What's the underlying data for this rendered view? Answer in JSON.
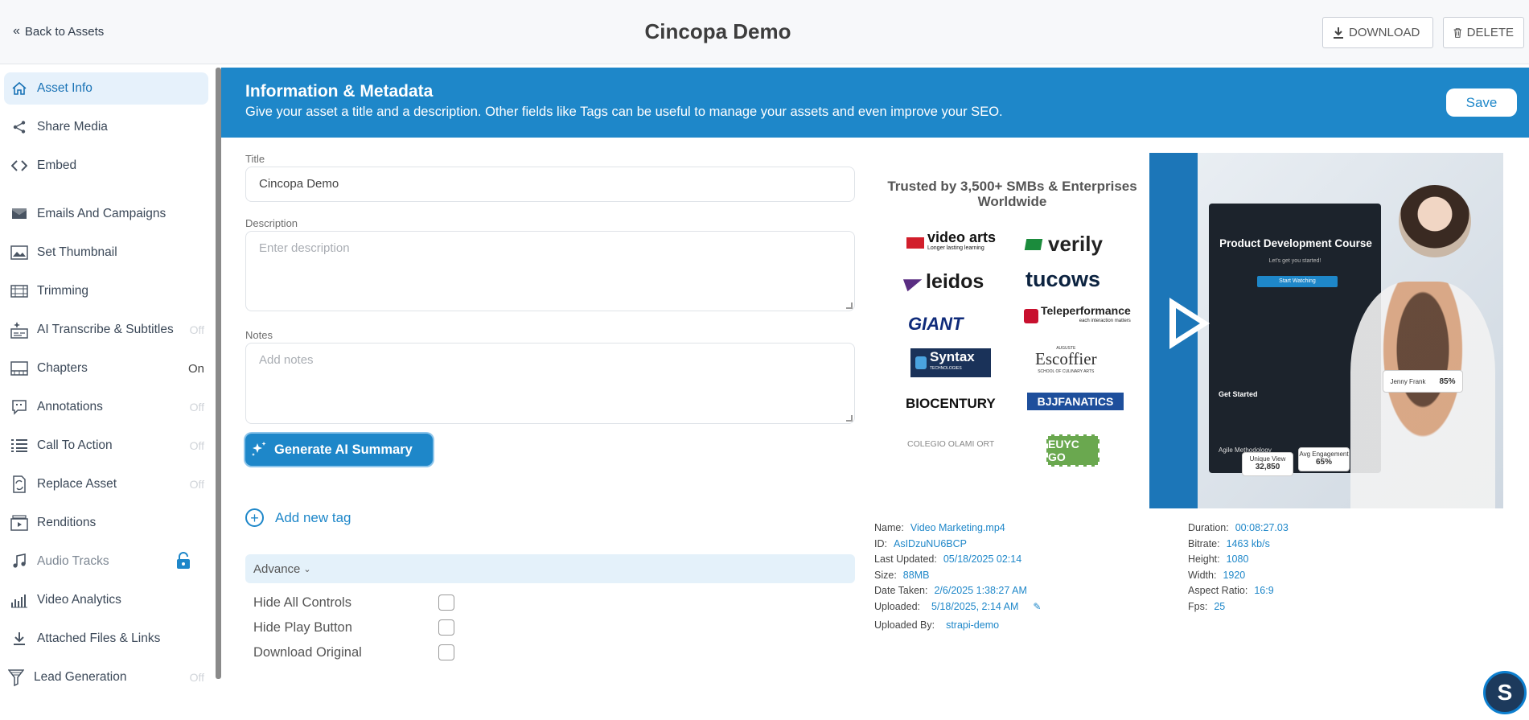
{
  "header": {
    "back_label": "Back to Assets",
    "title": "Cincopa Demo",
    "download_label": "DOWNLOAD",
    "delete_label": "DELETE"
  },
  "sidebar": {
    "items": [
      {
        "label": "Asset Info",
        "icon": "home-icon",
        "state": ""
      },
      {
        "label": "Share Media",
        "icon": "share-icon",
        "state": ""
      },
      {
        "label": "Embed",
        "icon": "code-icon",
        "state": ""
      },
      {
        "label": "Emails And Campaigns",
        "icon": "mail-icon",
        "state": ""
      },
      {
        "label": "Set Thumbnail",
        "icon": "image-icon",
        "state": ""
      },
      {
        "label": "Trimming",
        "icon": "trim-icon",
        "state": ""
      },
      {
        "label": "AI Transcribe & Subtitles",
        "icon": "ai-subtitles-icon",
        "state": "Off"
      },
      {
        "label": "Chapters",
        "icon": "chapters-icon",
        "state": "On"
      },
      {
        "label": "Annotations",
        "icon": "annotation-icon",
        "state": "Off"
      },
      {
        "label": "Call To Action",
        "icon": "list-icon",
        "state": "Off"
      },
      {
        "label": "Replace Asset",
        "icon": "replace-icon",
        "state": "Off"
      },
      {
        "label": "Renditions",
        "icon": "renditions-icon",
        "state": ""
      },
      {
        "label": "Audio Tracks",
        "icon": "music-icon",
        "state": "lock"
      },
      {
        "label": "Video Analytics",
        "icon": "analytics-icon",
        "state": ""
      },
      {
        "label": "Attached Files & Links",
        "icon": "download-icon",
        "state": ""
      },
      {
        "label": "Lead Generation",
        "icon": "funnel-icon",
        "state": "Off"
      }
    ]
  },
  "banner": {
    "title": "Information & Metadata",
    "subtitle": "Give your asset a title and a description. Other fields like Tags can be useful to manage your assets and even improve your SEO.",
    "save_label": "Save"
  },
  "form": {
    "title_label": "Title",
    "title_value": "Cincopa Demo",
    "description_label": "Description",
    "description_placeholder": "Enter description",
    "notes_label": "Notes",
    "notes_placeholder": "Add notes",
    "ai_button_label": "Generate AI Summary",
    "add_tag_label": "Add new tag",
    "advance_label": "Advance",
    "checkboxes": [
      {
        "label": "Hide All Controls",
        "checked": false
      },
      {
        "label": "Hide Play Button",
        "checked": false
      },
      {
        "label": "Download Original",
        "checked": false
      }
    ]
  },
  "preview": {
    "trusted_text": "Trusted by 3,500+ SMBs & Enterprises Worldwide",
    "logos": [
      "video arts",
      "verily",
      "leidos",
      "tucows",
      "GIANT",
      "Teleperformance",
      "Syntax",
      "Escoffier",
      "BIOCENTURY",
      "BJJFANATICS",
      "COLEGIO OLAMI ORT",
      "EUYC GO"
    ],
    "logo_sub_video_arts": "Longer lasting learning",
    "logo_sub_teleperformance": "each interaction matters",
    "logo_sub_syntax": "TECHNOLOGIES",
    "logo_sub_escoffier": "SCHOOL OF CULINARY ARTS",
    "logo_pre_escoffier": "AUGUSTE",
    "video_title": "Product Development Course",
    "video_sub": "Let's get you started!",
    "video_button": "Start Watching",
    "video_get_started": "Get Started",
    "video_methodology": "Agile Methodology",
    "video_badge_name": "Jenny Frank",
    "video_badge_pct": "85%",
    "video_unique_label": "Unique View",
    "video_unique_value": "32,850",
    "video_engagement_label": "Avg Engagement",
    "video_engagement_value": "65%"
  },
  "metadata": {
    "left": [
      {
        "key": "Name:",
        "value": "Video Marketing.mp4"
      },
      {
        "key": "ID:",
        "value": "AsIDzuNU6BCP"
      },
      {
        "key": "Last Updated:",
        "value": "05/18/2025 02:14"
      },
      {
        "key": "Size:",
        "value": "88MB"
      },
      {
        "key": "Date Taken:",
        "value": "2/6/2025 1:38:27 AM"
      },
      {
        "key": "Uploaded:",
        "value": "5/18/2025, 2:14 AM"
      }
    ],
    "uploaded_by_key": "Uploaded By:",
    "uploaded_by_value": "strapi-demo",
    "right": [
      {
        "key": "Duration:",
        "value": "00:08:27.03"
      },
      {
        "key": "Bitrate:",
        "value": "1463 kb/s"
      },
      {
        "key": "Height:",
        "value": "1080"
      },
      {
        "key": "Width:",
        "value": "1920"
      },
      {
        "key": "Aspect Ratio:",
        "value": "16:9"
      },
      {
        "key": "Fps:",
        "value": "25"
      }
    ]
  },
  "colors": {
    "accent": "#1e87c9",
    "active_bg": "#e6f1fb"
  }
}
